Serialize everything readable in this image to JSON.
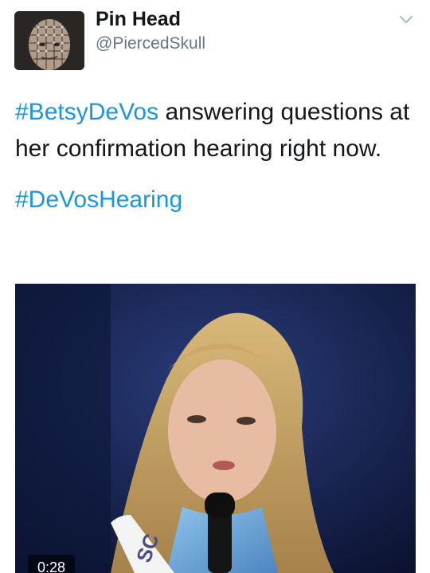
{
  "user": {
    "display_name": "Pin Head",
    "handle": "@PiercedSkull"
  },
  "tweet": {
    "hashtag_1": "#BetsyDeVos",
    "text": " answering questions at her confirmation hearing right now.",
    "hashtag_2": "#DeVosHearing"
  },
  "media": {
    "duration": "0:28",
    "sash_text": "SC"
  },
  "icons": {
    "menu": "chevron-down-icon"
  },
  "colors": {
    "hashtag": "#1b95e0",
    "handle": "#657786",
    "text": "#14171a"
  }
}
